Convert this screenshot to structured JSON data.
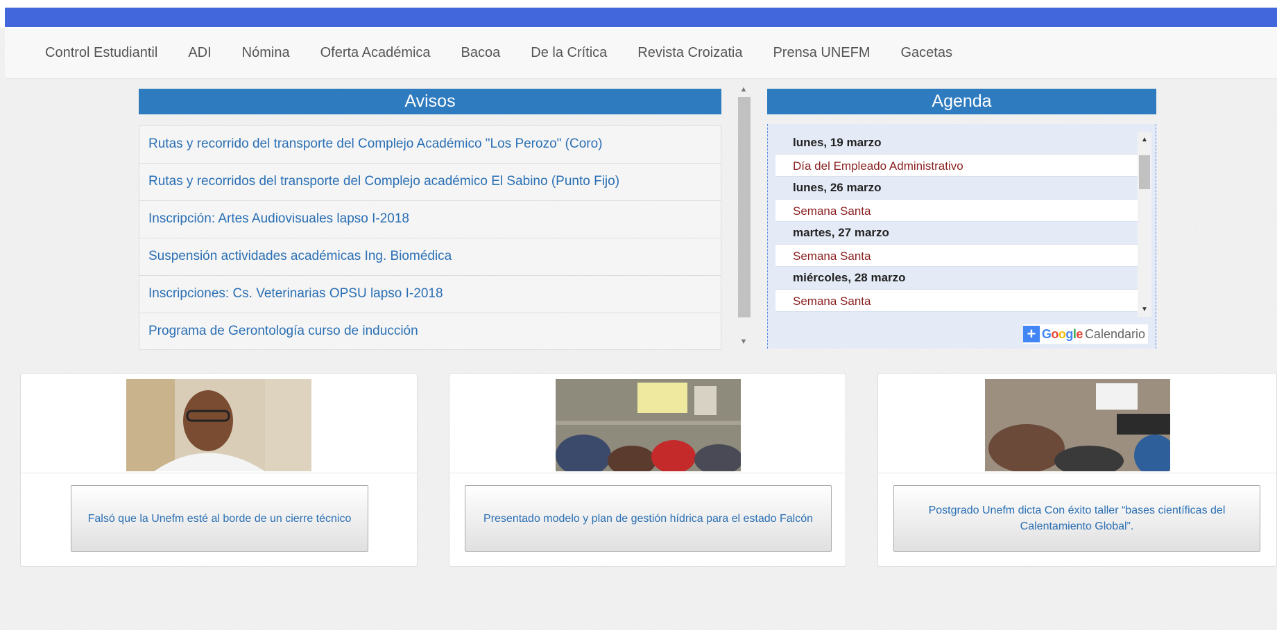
{
  "nav": {
    "items": [
      "Control Estudiantil",
      "ADI",
      "Nómina",
      "Oferta Académica",
      "Bacoa",
      "De la Crítica",
      "Revista Croizatia",
      "Prensa UNEFM",
      "Gacetas"
    ]
  },
  "avisos": {
    "title": "Avisos",
    "items": [
      "Rutas y recorrido del transporte del Complejo Académico \"Los Perozo\" (Coro)",
      "Rutas y recorridos del transporte del Complejo académico El Sabino (Punto Fijo)",
      "Inscripción: Artes Audiovisuales lapso I-2018",
      "Suspensión actividades académicas Ing. Biomédica",
      "Inscripciones: Cs. Veterinarias OPSU lapso I-2018",
      "Programa de Gerontología curso de inducción"
    ]
  },
  "agenda": {
    "title": "Agenda",
    "entries": [
      {
        "date": "lunes, 19 marzo",
        "event": "Día del Empleado Administrativo"
      },
      {
        "date": "lunes, 26 marzo",
        "event": "Semana Santa"
      },
      {
        "date": "martes, 27 marzo",
        "event": "Semana Santa"
      },
      {
        "date": "miércoles, 28 marzo",
        "event": "Semana Santa"
      }
    ],
    "badge": {
      "plus": "+",
      "google": "Google",
      "calendar": "Calendario"
    }
  },
  "news": [
    {
      "label": "Falsó que la Unefm esté al borde de un cierre técnico",
      "image_icon": "man-portrait-photo"
    },
    {
      "label": "Presentado modelo y plan de gestión hídrica para el estado Falcón",
      "image_icon": "auditorium-presentation-photo"
    },
    {
      "label": "Postgrado Unefm dicta Con éxito taller “bases científicas del Calentamiento Global”.",
      "image_icon": "classroom-lecture-photo"
    }
  ],
  "colors": {
    "topbar": "#4267dd",
    "panel_header": "#2f7bbf",
    "link": "#2a6fb4",
    "event": "#8a1f1f"
  }
}
